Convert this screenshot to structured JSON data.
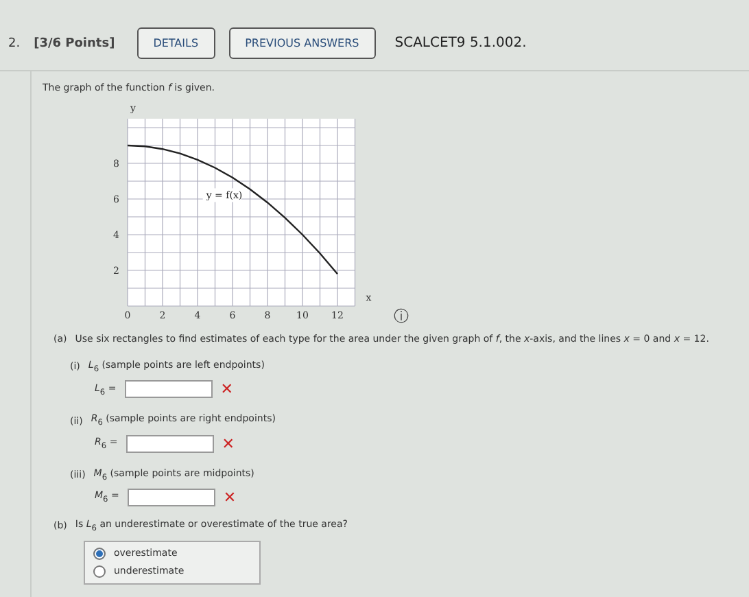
{
  "question": {
    "number": "2.",
    "points": "[3/6 Points]",
    "buttons": [
      "DETAILS",
      "PREVIOUS ANSWERS"
    ],
    "source": "SCALCET9 5.1.002."
  },
  "intro": "The graph of the function *f* is given.",
  "graph": {
    "chart_data": {
      "type": "line",
      "xlabel": "x",
      "ylabel": "y",
      "x": [
        0,
        1,
        2,
        3,
        4,
        5,
        6,
        7,
        8,
        9,
        10,
        11,
        12
      ],
      "series": [
        {
          "name": "y = f(x)",
          "color": "#222222",
          "values": [
            9,
            8.95,
            8.8,
            8.55,
            8.2,
            7.75,
            7.2,
            6.55,
            5.8,
            4.95,
            4,
            2.95,
            1.8
          ]
        }
      ],
      "xlim": [
        0,
        13
      ],
      "ylim": [
        0,
        10.5
      ],
      "xticks": [
        0,
        2,
        4,
        6,
        8,
        10,
        12
      ],
      "yticks": [
        2,
        4,
        6,
        8
      ],
      "grid": true
    }
  },
  "info_icon": "ⓘ",
  "part_a": {
    "label": "(a)",
    "text": "Use six rectangles to find estimates of each type for the area under the given graph of *f*, the *x*-axis, and the lines *x* = 0 and *x* = 12.",
    "items": [
      {
        "label": "(i)",
        "title": "*L*$_{6}$ (sample points are left endpoints)",
        "var": "*L*$_{6}$ =",
        "correct": false,
        "mark": "✕"
      },
      {
        "label": "(ii)",
        "title": "*R*$_{6}$ (sample points are right endpoints)",
        "var": "*R*$_{6}$ =",
        "correct": false,
        "mark": "✕"
      },
      {
        "label": "(iii)",
        "title": "*M*$_{6}$ (sample points are midpoints)",
        "var": "*M*$_{6}$ =",
        "correct": false,
        "mark": "✕"
      }
    ]
  },
  "part_b": {
    "label": "(b)",
    "text": "Is *L*$_{6}$ an underestimate or overestimate of the true area?",
    "options": [
      {
        "label": "overestimate",
        "selected": true
      },
      {
        "label": "underestimate",
        "selected": false
      }
    ]
  }
}
